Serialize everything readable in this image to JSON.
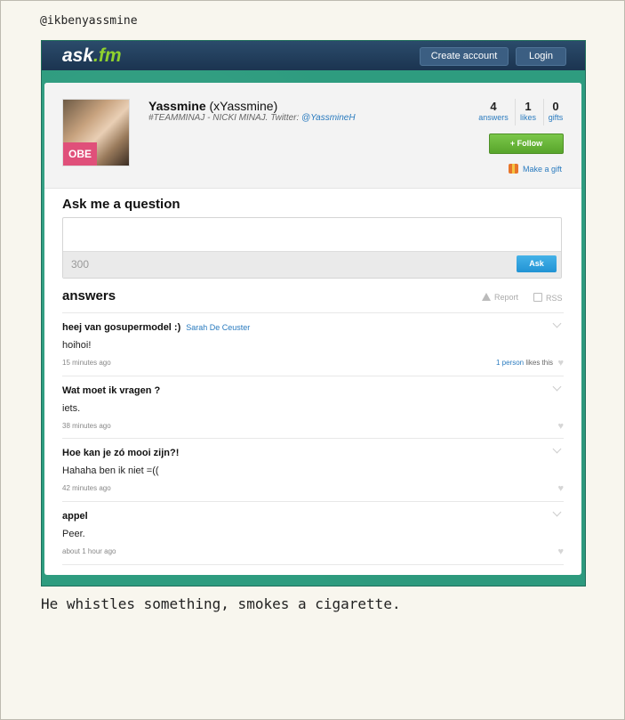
{
  "captions": {
    "top": "@ikbenyassmine",
    "bottom": "He whistles something, smokes a cigarette."
  },
  "topbar": {
    "logo_main": "ask",
    "logo_fm": ".fm",
    "create_account_label": "Create account",
    "login_label": "Login"
  },
  "profile": {
    "name": "Yassmine",
    "username": "(xYassmine)",
    "bio": "#TEAMMINAJ - NICKI MINAJ. Twitter: ",
    "twitter": "@YassmineH",
    "avatar_shirt_text": "OBE",
    "stats": [
      {
        "value": "4",
        "label": "answers"
      },
      {
        "value": "1",
        "label": "likes"
      },
      {
        "value": "0",
        "label": "gifts"
      }
    ],
    "follow_label": "+ Follow",
    "gift_label": "Make a gift"
  },
  "ask": {
    "heading": "Ask me a question",
    "counter": "300",
    "button_label": "Ask"
  },
  "answers": {
    "heading": "answers",
    "report_label": "Report",
    "rss_label": "RSS",
    "items": [
      {
        "question": "heej van gosupermodel :)",
        "asker": "Sarah De Ceuster",
        "answer": "hoihoi!",
        "time": "15 minutes ago",
        "likes_link": "1 person",
        "likes_text": " likes this"
      },
      {
        "question": "Wat moet ik vragen ?",
        "asker": "",
        "answer": "iets.",
        "time": "38 minutes ago",
        "likes_link": "",
        "likes_text": ""
      },
      {
        "question": "Hoe kan je zó mooi zijn?!",
        "asker": "",
        "answer": "Hahaha ben ik niet =((",
        "time": "42 minutes ago",
        "likes_link": "",
        "likes_text": ""
      },
      {
        "question": "appel",
        "asker": "",
        "answer": "Peer.",
        "time": "about 1 hour ago",
        "likes_link": "",
        "likes_text": ""
      }
    ]
  },
  "colors": {
    "background_teal": "#2e9c7f",
    "topbar_navy": "#1b3450",
    "follow_green": "#58a52b",
    "ask_blue": "#2193d4",
    "link_blue": "#2a7bbf"
  }
}
